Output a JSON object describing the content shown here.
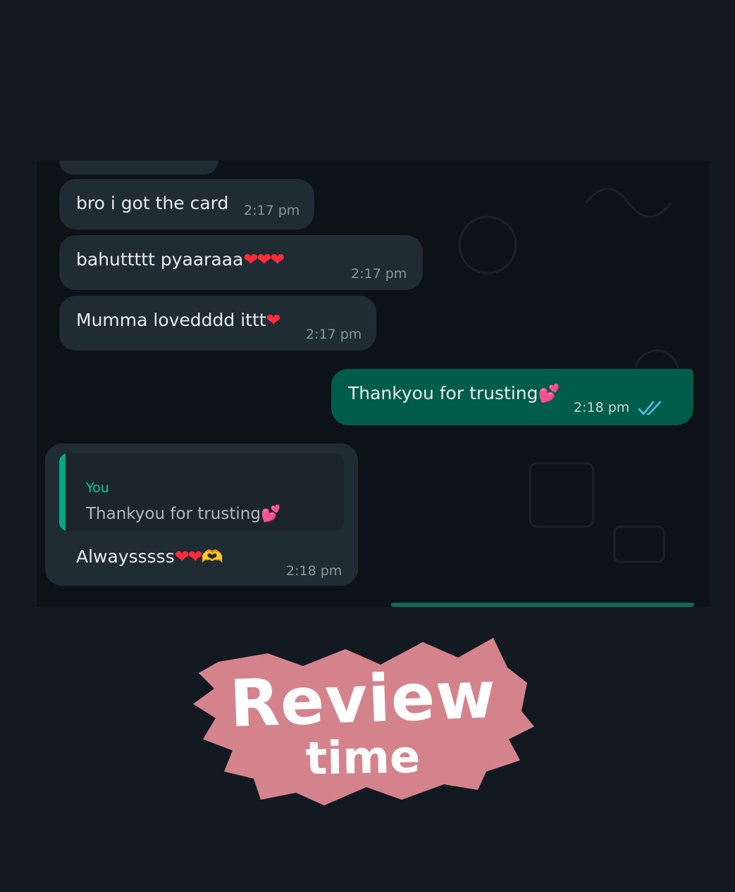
{
  "messages": [
    {
      "id": "m1",
      "direction": "incoming",
      "text": "bro i got the card",
      "emoji": "",
      "time": "2:17 pm"
    },
    {
      "id": "m2",
      "direction": "incoming",
      "text": "bahuttttt pyaaraaa",
      "emoji": "❤❤❤",
      "time": "2:17 pm"
    },
    {
      "id": "m3",
      "direction": "incoming",
      "text": "Mumma lovedddd ittt",
      "emoji": "❤",
      "time": "2:17 pm"
    },
    {
      "id": "m4",
      "direction": "outgoing",
      "text": "Thankyou for trusting",
      "emoji": "💕",
      "time": "2:18 pm",
      "status_icon": "double-check-read-icon"
    },
    {
      "id": "m5",
      "direction": "incoming",
      "text": "Alwaysssss",
      "emoji": "❤❤",
      "emoji_extra": "🫶",
      "time": "2:18 pm",
      "reply": {
        "author": "You",
        "text": "Thankyou for trusting",
        "emoji": "💕"
      }
    }
  ],
  "badge": {
    "title": "Review",
    "subtitle": "time",
    "color": "#d4838c"
  },
  "colors": {
    "incoming_bubble": "#202c33",
    "outgoing_bubble": "#005c4b",
    "read_ticks": "#53bdeb",
    "reply_accent": "#06a884"
  }
}
